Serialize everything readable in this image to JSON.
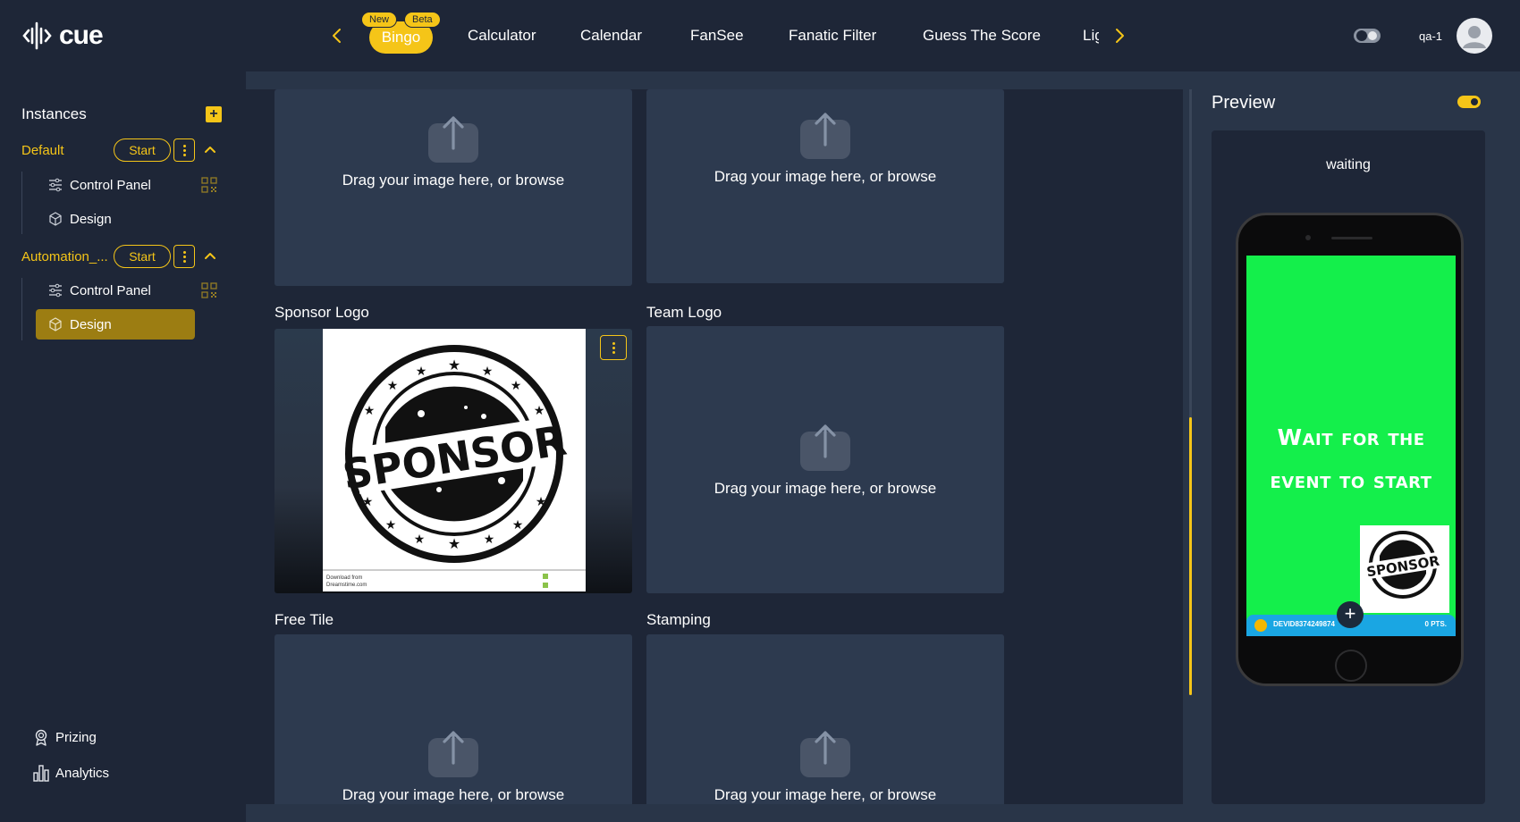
{
  "app": {
    "logo_text": "cue"
  },
  "header": {
    "tabs": [
      {
        "label": "Bingo"
      },
      {
        "label": "Calculator"
      },
      {
        "label": "Calendar"
      },
      {
        "label": "FanSee"
      },
      {
        "label": "Fanatic Filter"
      },
      {
        "label": "Guess The Score"
      },
      {
        "label": "Lig"
      }
    ],
    "active_tab_badges": {
      "new": "New",
      "beta": "Beta"
    },
    "user_label": "qa-1"
  },
  "sidebar": {
    "title": "Instances",
    "add_label": "+",
    "instances": [
      {
        "name": "Default",
        "start_label": "Start",
        "items": [
          {
            "label": "Control Panel"
          },
          {
            "label": "Design"
          }
        ]
      },
      {
        "name": "Automation_...",
        "start_label": "Start",
        "items": [
          {
            "label": "Control Panel"
          },
          {
            "label": "Design"
          }
        ]
      }
    ],
    "footer": [
      {
        "label": "Prizing"
      },
      {
        "label": "Analytics"
      }
    ]
  },
  "main": {
    "dropzone_text": "Drag your image here, or browse",
    "sections": {
      "sponsor_logo": "Sponsor Logo",
      "team_logo": "Team Logo",
      "free_tile": "Free Tile",
      "stamping": "Stamping"
    },
    "sponsor_image": {
      "stamp_text": "SPONSOR",
      "footer_line_1": "Download from",
      "footer_line_2": "Dreamstime.com"
    }
  },
  "preview": {
    "title": "Preview",
    "status": "waiting",
    "headline_line_1": "Wait for the",
    "headline_line_2": "event to start",
    "ad_text": "SPONSOR",
    "user_id": "DEVID8374249874",
    "points": "0 PTS.",
    "plus": "+"
  },
  "colors": {
    "accent": "#f5c518",
    "background": "#1e2637",
    "panel": "#2d3a4f",
    "phone_screen": "#14ef4b",
    "phone_bar": "#1aa6e3"
  },
  "icons": {
    "nav_prev": "chevron-left-icon",
    "nav_next": "chevron-right-icon",
    "upload": "upload-icon",
    "control_panel": "sliders-icon",
    "design": "cube-icon",
    "qr": "qr-code-icon",
    "prizing": "award-icon",
    "analytics": "bar-chart-icon"
  }
}
